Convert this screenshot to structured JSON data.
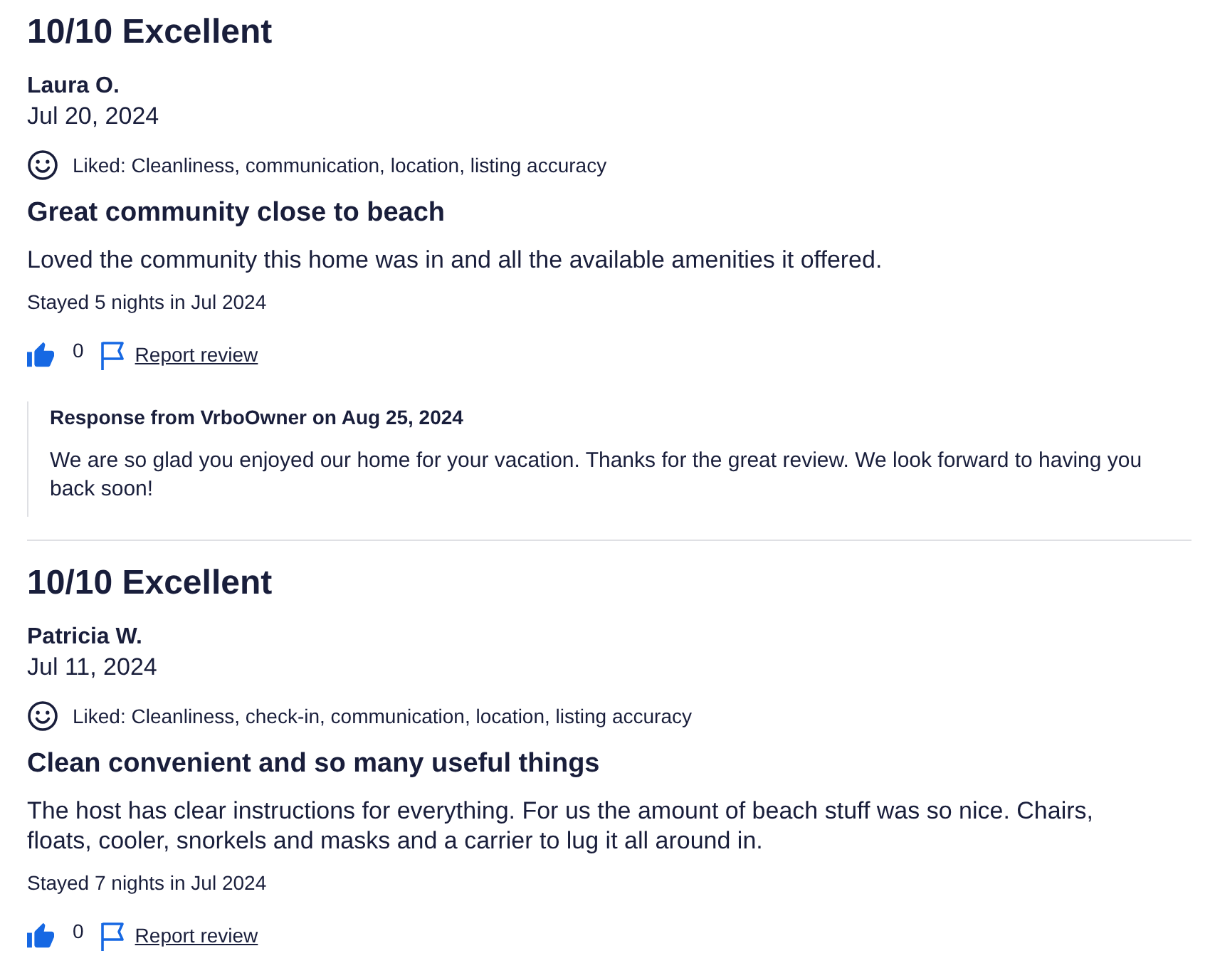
{
  "reviews": [
    {
      "rating": "10/10 Excellent",
      "author": "Laura O.",
      "date": "Jul 20, 2024",
      "liked": "Liked: Cleanliness, communication, location, listing accuracy",
      "title": "Great community close to beach",
      "body": "Loved the community this home was in and all the available amenities it offered.",
      "stay": "Stayed 5 nights in Jul 2024",
      "helpful_count": "0",
      "report_link": "Report review",
      "response": {
        "heading": "Response from VrboOwner on Aug 25, 2024",
        "text": "We are so glad you enjoyed our home for your vacation. Thanks for the great review. We look forward to having you back soon!"
      }
    },
    {
      "rating": "10/10 Excellent",
      "author": "Patricia W.",
      "date": "Jul 11, 2024",
      "liked": "Liked: Cleanliness, check-in, communication, location, listing accuracy",
      "title": "Clean convenient and so many useful things",
      "body": "The host has clear instructions for everything. For us the amount of beach stuff was so nice. Chairs, floats, cooler, snorkels and masks and a carrier to lug it all around in.",
      "stay": "Stayed 7 nights in Jul 2024",
      "helpful_count": "0",
      "report_link": "Report review"
    }
  ]
}
